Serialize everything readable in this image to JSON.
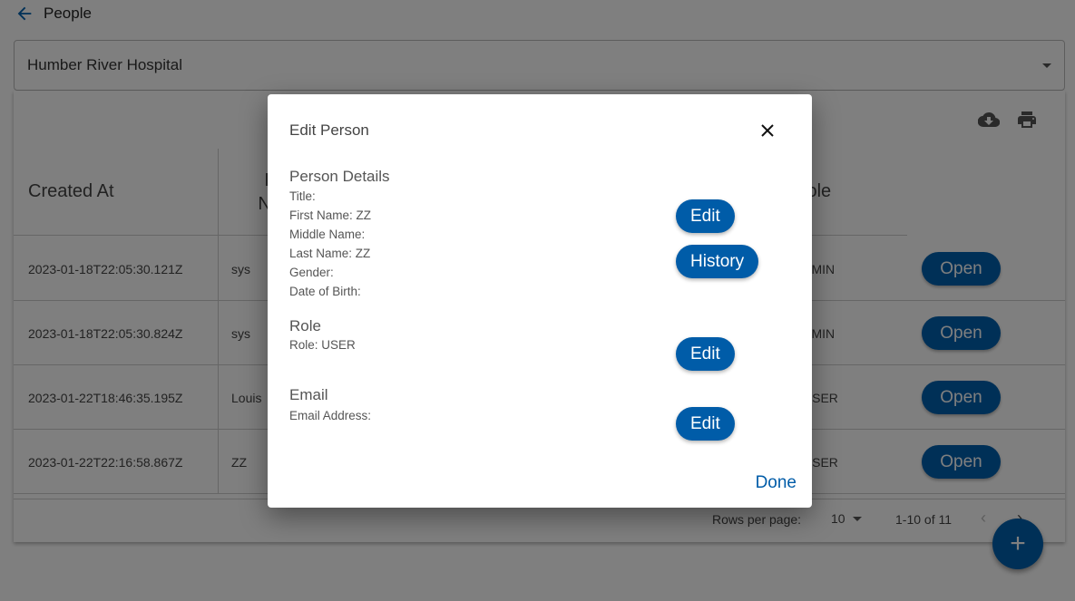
{
  "header": {
    "back_label": "People"
  },
  "filter": {
    "selected": "Humber River Hospital"
  },
  "table": {
    "columns": [
      "Created At",
      "First Name",
      "Role"
    ],
    "rows": [
      {
        "created_at": "2023-01-18T22:05:30.121Z",
        "first_name": "sys",
        "role": "ADMIN",
        "action": "Open"
      },
      {
        "created_at": "2023-01-18T22:05:30.824Z",
        "first_name": "sys",
        "role": "ADMIN",
        "action": "Open"
      },
      {
        "created_at": "2023-01-22T18:46:35.195Z",
        "first_name": "Louis",
        "role": "USER",
        "action": "Open"
      },
      {
        "created_at": "2023-01-22T22:16:58.867Z",
        "first_name": "ZZ",
        "role": "USER",
        "action": "Open"
      }
    ],
    "footer": {
      "rows_per_page_label": "Rows per page:",
      "rows_per_page": "10",
      "range": "1-10 of 11"
    }
  },
  "fab": {
    "label": "+"
  },
  "modal": {
    "title": "Edit Person",
    "person_details": {
      "heading": "Person Details",
      "lines": [
        "Title:",
        "First Name: ZZ",
        "Middle Name:",
        "Last Name: ZZ",
        "Gender:",
        "Date of Birth:"
      ],
      "edit": "Edit",
      "history": "History"
    },
    "role": {
      "heading": "Role",
      "lines": [
        "Role: USER"
      ],
      "edit": "Edit"
    },
    "email": {
      "heading": "Email",
      "lines": [
        "Email Address:"
      ],
      "edit": "Edit"
    },
    "done": "Done"
  },
  "colors": {
    "primary": "#005ca8",
    "overlay": "rgba(0,0,0,0.5)"
  }
}
